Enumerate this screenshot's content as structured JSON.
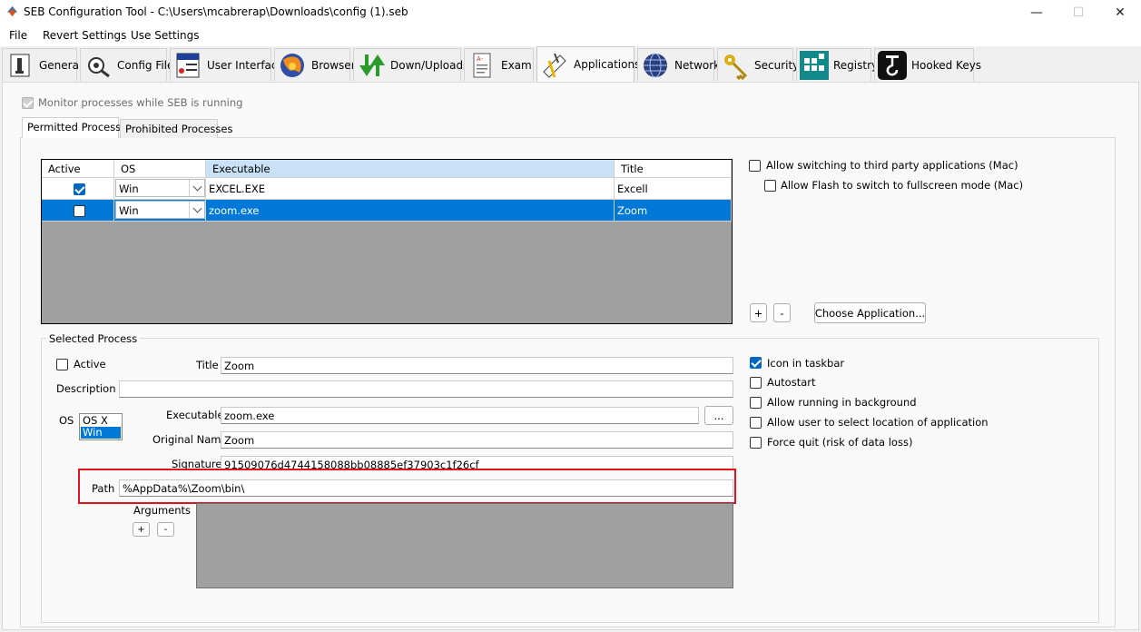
{
  "window": {
    "title": "SEB Configuration Tool - C:\\Users\\mcabrerap\\Downloads\\config (1).seb",
    "minimize": "—",
    "maximize": "☐",
    "close": "✕"
  },
  "menu": [
    "File",
    "Revert Settings",
    "Use Settings"
  ],
  "tabs": [
    {
      "label": "General",
      "icon": "general-icon"
    },
    {
      "label": "Config File",
      "icon": "config-file-icon"
    },
    {
      "label": "User Interface",
      "icon": "user-interface-icon"
    },
    {
      "label": "Browser",
      "icon": "browser-icon"
    },
    {
      "label": "Down/Uploads",
      "icon": "down-uploads-icon"
    },
    {
      "label": "Exam",
      "icon": "exam-icon"
    },
    {
      "label": "Applications",
      "icon": "applications-icon"
    },
    {
      "label": "Network",
      "icon": "network-icon"
    },
    {
      "label": "Security",
      "icon": "security-icon"
    },
    {
      "label": "Registry",
      "icon": "registry-icon"
    },
    {
      "label": "Hooked Keys",
      "icon": "hooked-keys-icon"
    }
  ],
  "active_tab": "Applications",
  "monitor_processes": "Monitor processes while SEB is running",
  "subtabs": [
    "Permitted Processes",
    "Prohibited Processes"
  ],
  "grid": {
    "headers": [
      "Active",
      "OS",
      "Executable",
      "Title"
    ],
    "rows": [
      {
        "active": true,
        "os": "Win",
        "executable": "EXCEL.EXE",
        "title": "Excell"
      },
      {
        "active": false,
        "os": "Win",
        "executable": "zoom.exe",
        "title": "Zoom"
      }
    ]
  },
  "right_options": {
    "allow_third_party": "Allow switching to third party applications (Mac)",
    "allow_flash": "Allow Flash to switch to fullscreen mode (Mac)"
  },
  "buttons": {
    "add": "+",
    "remove": "-",
    "choose_application": "Choose Application...",
    "browse": "..."
  },
  "selected_process": {
    "group_title": "Selected Process",
    "active_label": "Active",
    "title_label": "Title",
    "title_value": "Zoom",
    "description_label": "Description",
    "description_value": "",
    "os_label": "OS",
    "os_options": [
      "OS X",
      "Win"
    ],
    "os_selected": "Win",
    "executable_label": "Executable",
    "executable_value": "zoom.exe",
    "original_name_label": "Original Name",
    "original_name_value": "Zoom",
    "signature_label": "Signature",
    "signature_value": "91509076d4744158088bb08885ef37903c1f26cf",
    "path_label": "Path",
    "path_value": "%AppData%\\Zoom\\bin\\",
    "arguments_label": "Arguments"
  },
  "process_options": [
    {
      "label": "Icon in taskbar",
      "checked": true
    },
    {
      "label": "Autostart",
      "checked": false
    },
    {
      "label": "Allow running in background",
      "checked": false
    },
    {
      "label": "Allow user to select location of application",
      "checked": false
    },
    {
      "label": "Force quit (risk of data loss)",
      "checked": false
    }
  ],
  "colors": {
    "highlight_box": "#e0141e",
    "selection": "#0078d7",
    "grid_empty": "#a0a0a0"
  }
}
